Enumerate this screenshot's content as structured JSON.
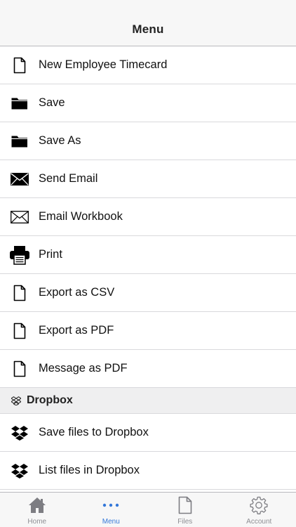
{
  "navbar": {
    "title": "Menu"
  },
  "menu": {
    "items": [
      {
        "label": "New Employee Timecard",
        "icon": "document-icon"
      },
      {
        "label": "Save",
        "icon": "folder-icon"
      },
      {
        "label": "Save As",
        "icon": "folder-icon"
      },
      {
        "label": "Send Email",
        "icon": "envelope-filled-icon"
      },
      {
        "label": "Email Workbook",
        "icon": "envelope-outline-icon"
      },
      {
        "label": "Print",
        "icon": "printer-icon"
      },
      {
        "label": "Export as CSV",
        "icon": "document-icon"
      },
      {
        "label": "Export as PDF",
        "icon": "document-icon"
      },
      {
        "label": "Message as PDF",
        "icon": "document-icon"
      }
    ]
  },
  "dropbox": {
    "header": "Dropbox",
    "items": [
      {
        "label": "Save files to Dropbox",
        "icon": "dropbox-icon"
      },
      {
        "label": "List files in Dropbox",
        "icon": "dropbox-icon"
      }
    ]
  },
  "tabbar": {
    "tabs": [
      {
        "label": "Home",
        "icon": "home-icon",
        "active": false
      },
      {
        "label": "Menu",
        "icon": "more-dots-icon",
        "active": true
      },
      {
        "label": "Files",
        "icon": "file-icon",
        "active": false
      },
      {
        "label": "Account",
        "icon": "gear-icon",
        "active": false
      }
    ],
    "active_color": "#3478d9",
    "inactive_color": "#8e8e93"
  }
}
